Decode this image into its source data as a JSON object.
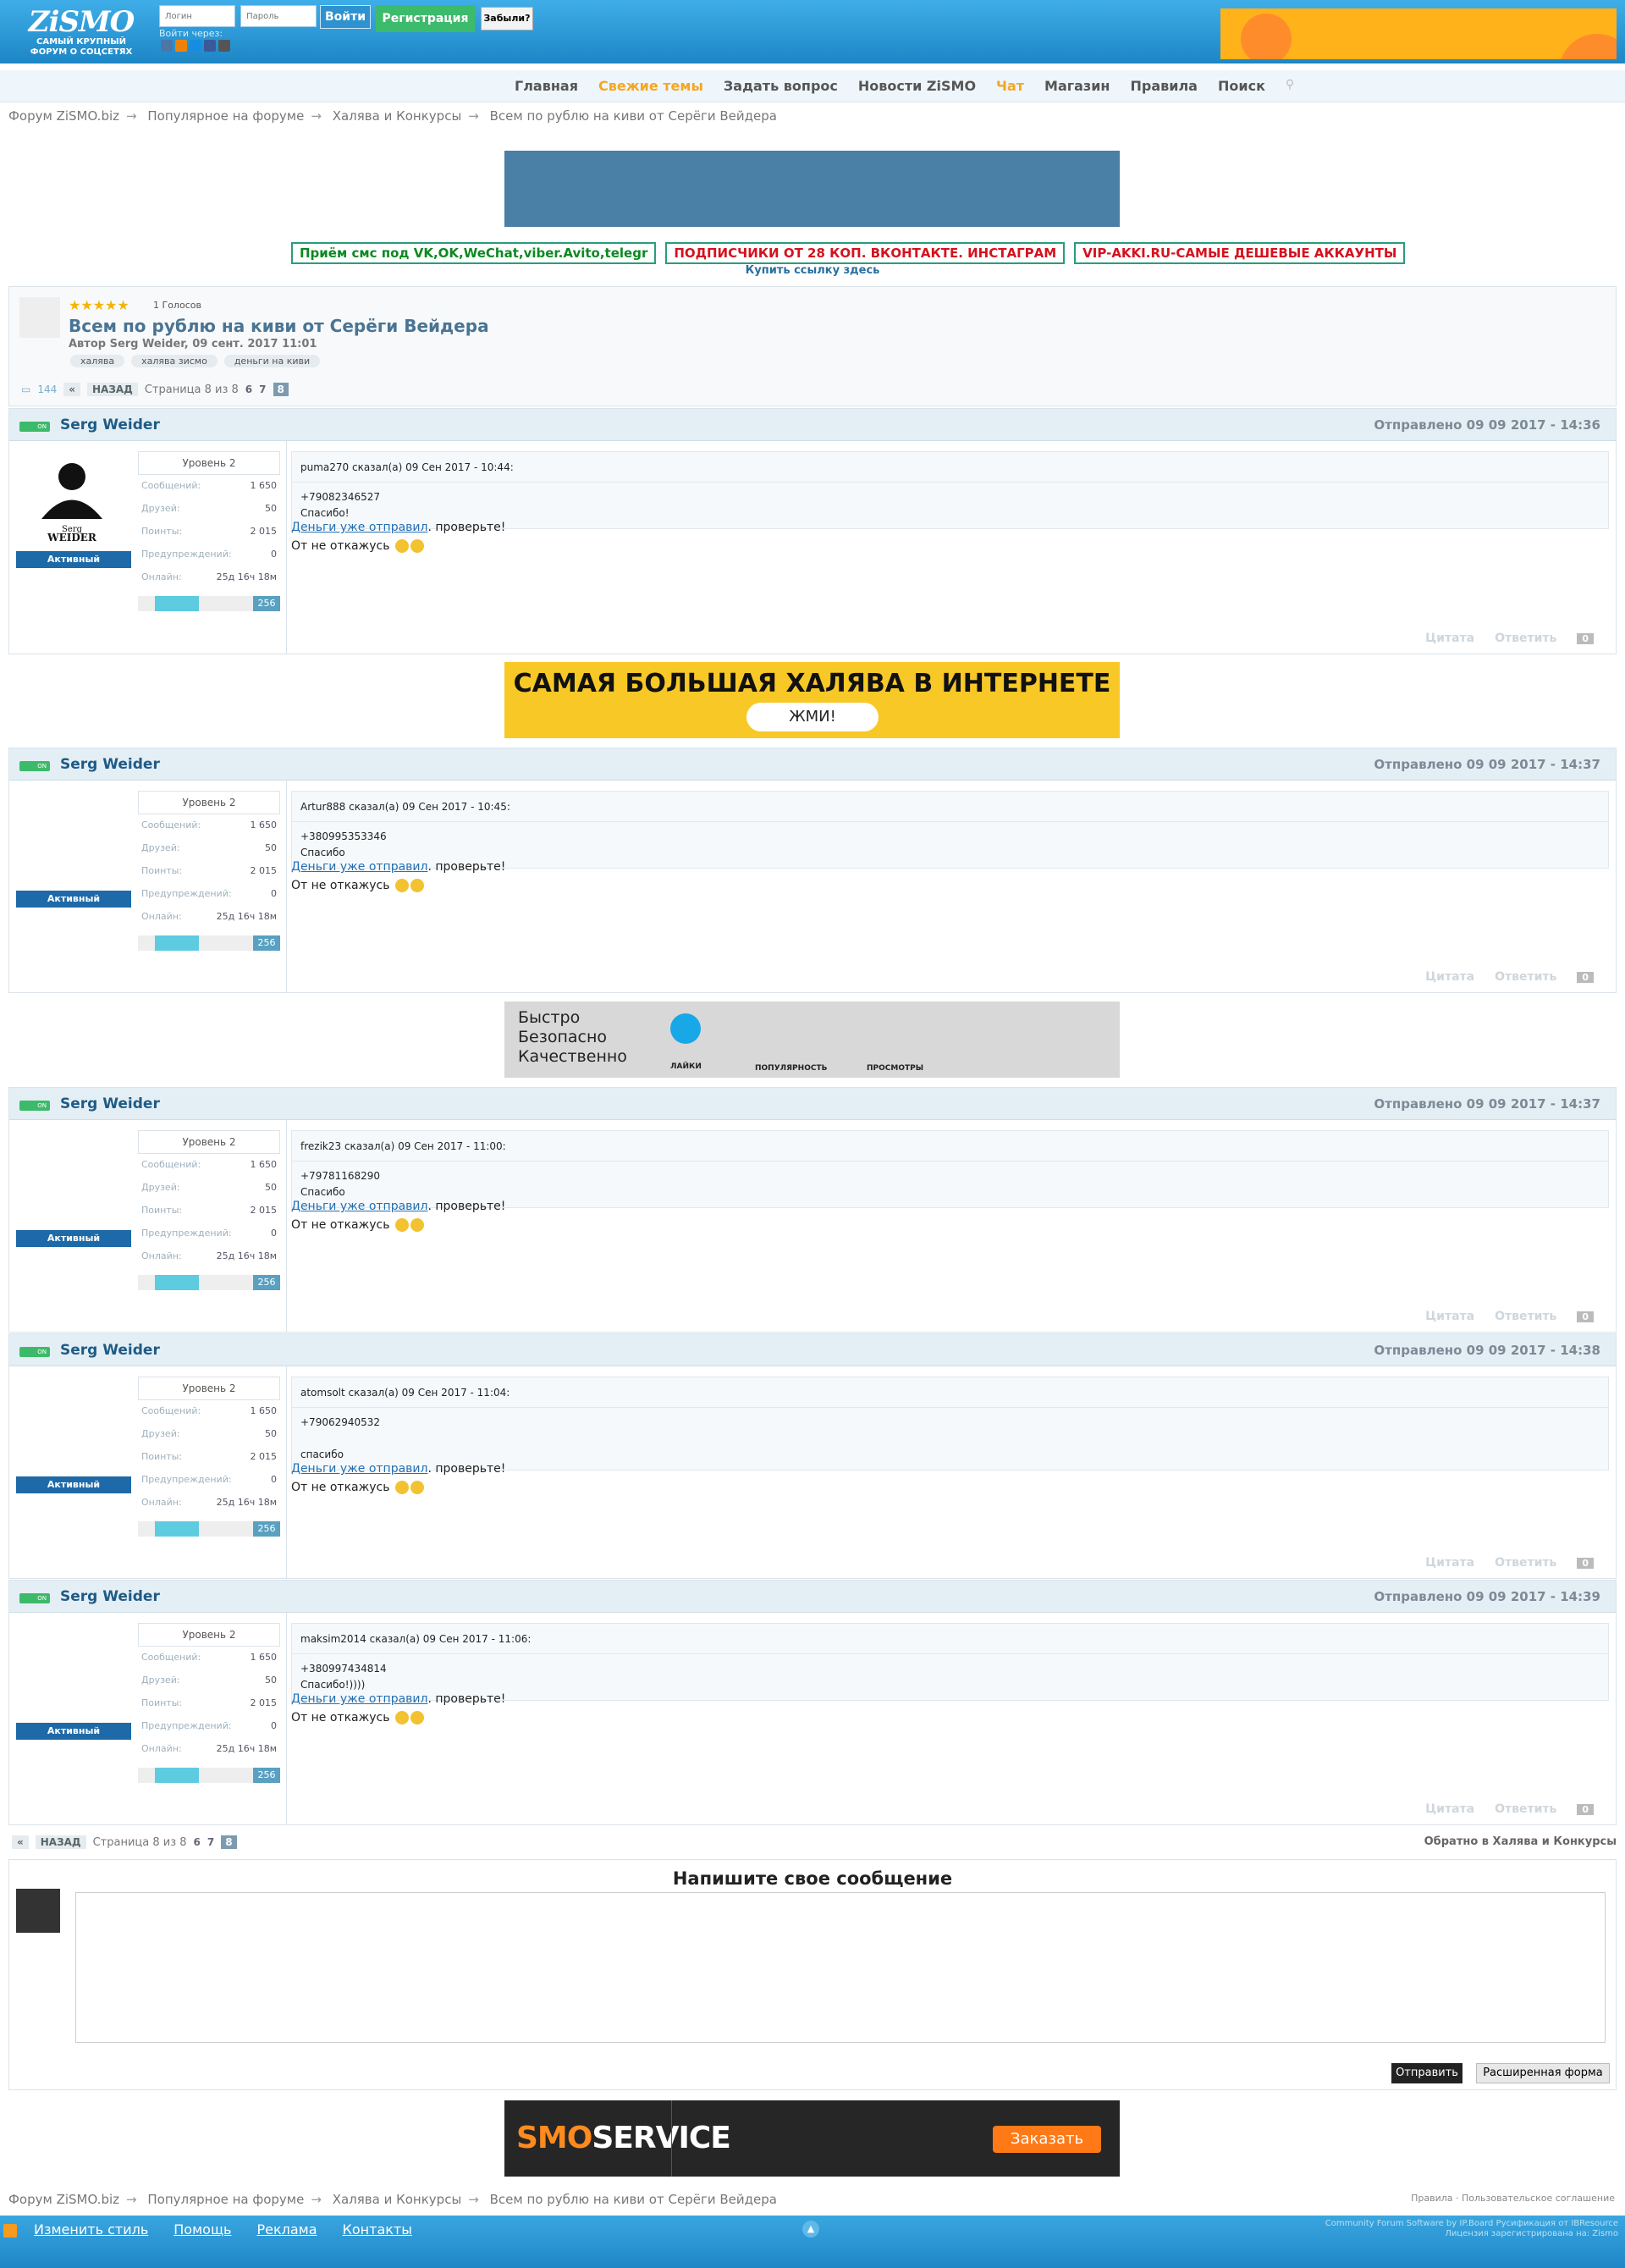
{
  "header": {
    "logo": "ZiSMO",
    "logo_sub": "САМЫЙ КРУПНЫЙ ФОРУМ О СОЦСЕТЯХ",
    "login_placeholder": "Логин",
    "password_placeholder": "Пароль",
    "login_button": "Войти",
    "register_button": "Регистрация",
    "forgot_button": "Забыли?",
    "login_via": "Войти через:"
  },
  "nav": {
    "items": [
      "Главная",
      "Свежие темы",
      "Задать вопрос",
      "Новости ZiSMO",
      "Чат",
      "Магазин",
      "Правила",
      "Поиск"
    ]
  },
  "breadcrumb": [
    "Форум ZiSMO.biz",
    "Популярное на форуме",
    "Халява и Конкурсы",
    "Всем по рублю на киви от Серёги Вейдера"
  ],
  "links": [
    "Приём смс под VK,OK,WeChat,viber.Avito,telegr",
    "ПОДПИСЧИКИ ОТ 28 КОП. ВКОНТАКТЕ. ИНСТАГРАМ",
    "VIP-AKKI.RU-САМЫЕ ДЕШЕВЫЕ АККАУНТЫ"
  ],
  "buy_link": "Купить ссылку здесь",
  "topic": {
    "stars": "★★★★★",
    "votes": "1 Голосов",
    "title": "Всем по рублю на киви от Серёги Вейдера",
    "author": "Автор Serg Weider, 09 сент. 2017 11:01",
    "tags": [
      "халява",
      "халява зисмо",
      "деньги на киви"
    ],
    "replies": "144"
  },
  "pager": {
    "back": "НАЗАД",
    "count": "Страница 8 из 8",
    "pages": [
      "6",
      "7",
      "8"
    ],
    "return": "Обратно в Халява и Конкурсы"
  },
  "ads": {
    "banner1": "САМАЯ БОЛЬШАЯ ХАЛЯВА В ИНТЕРНЕТЕ",
    "banner1_button": "ЖМИ!",
    "banner2_lines": [
      "Быстро",
      "Безопасно",
      "Качественно"
    ],
    "banner2_labels": [
      "ЛАЙКИ",
      "ПОПУЛЯРНОСТЬ",
      "ПРОСМОТРЫ"
    ],
    "smo_a": "SMO",
    "smo_b": "SERVICE",
    "smo_button": "Заказать"
  },
  "author": {
    "name": "Serg Weider",
    "online_badge": "ON",
    "level": "Уровень 2",
    "status": "Активный",
    "stats": [
      {
        "label": "Сообщений:",
        "value": "1 650"
      },
      {
        "label": "Друзей:",
        "value": "50"
      },
      {
        "label": "Поинты:",
        "value": "2 015"
      },
      {
        "label": "Предупреждений:",
        "value": "0"
      },
      {
        "label": "Онлайн:",
        "value": "25д 16ч 18м"
      }
    ],
    "rep": "256"
  },
  "posts": [
    {
      "date": "Отправлено 09 09 2017 - 14:36",
      "quote_head": "puma270 сказал(а) 09 Сен 2017 - 10:44:",
      "quote_lines": [
        "+79082346527",
        "Спасибо!"
      ],
      "link": "Деньги уже отправил",
      "rest": ". проверьте!",
      "line2": "От не откажусь"
    },
    {
      "date": "Отправлено 09 09 2017 - 14:37",
      "quote_head": "Artur888 сказал(а) 09 Сен 2017 - 10:45:",
      "quote_lines": [
        "+380995353346",
        "Спасибо"
      ],
      "link": "Деньги уже отправил",
      "rest": ". проверьте!",
      "line2": "От не откажусь"
    },
    {
      "date": "Отправлено 09 09 2017 - 14:37",
      "quote_head": "frezik23 сказал(а) 09 Сен 2017 - 11:00:",
      "quote_lines": [
        "+79781168290",
        "Спасибо"
      ],
      "link": "Деньги уже отправил",
      "rest": ". проверьте!",
      "line2": "От не откажусь"
    },
    {
      "date": "Отправлено 09 09 2017 - 14:38",
      "quote_head": "atomsolt сказал(а) 09 Сен 2017 - 11:04:",
      "quote_lines": [
        "+79062940532",
        "",
        "спасибо"
      ],
      "link": "Деньги уже отправил",
      "rest": ". проверьте!",
      "line2": "От не откажусь"
    },
    {
      "date": "Отправлено 09 09 2017 - 14:39",
      "quote_head": "maksim2014 сказал(а) 09 Сен 2017 - 11:06:",
      "quote_lines": [
        "+380997434814",
        "Спасибо!))))"
      ],
      "link": "Деньги уже отправил",
      "rest": ". проверьте!",
      "line2": "От не откажусь"
    }
  ],
  "post_actions": {
    "quote": "Цитата",
    "reply": "Ответить",
    "zero": "0"
  },
  "reply": {
    "title": "Напишите свое сообщение",
    "send": "Отправить",
    "extended": "Расширенная форма"
  },
  "footer": {
    "rules": "Правила · Пользовательское соглашение",
    "links": [
      "Изменить стиль",
      "Помощь",
      "Реклама",
      "Контакты"
    ],
    "copy1": "Community Forum Software by IP.Board Русификация от IBResource",
    "copy2": "Лицензия зарегистрирована на: Zismo"
  }
}
